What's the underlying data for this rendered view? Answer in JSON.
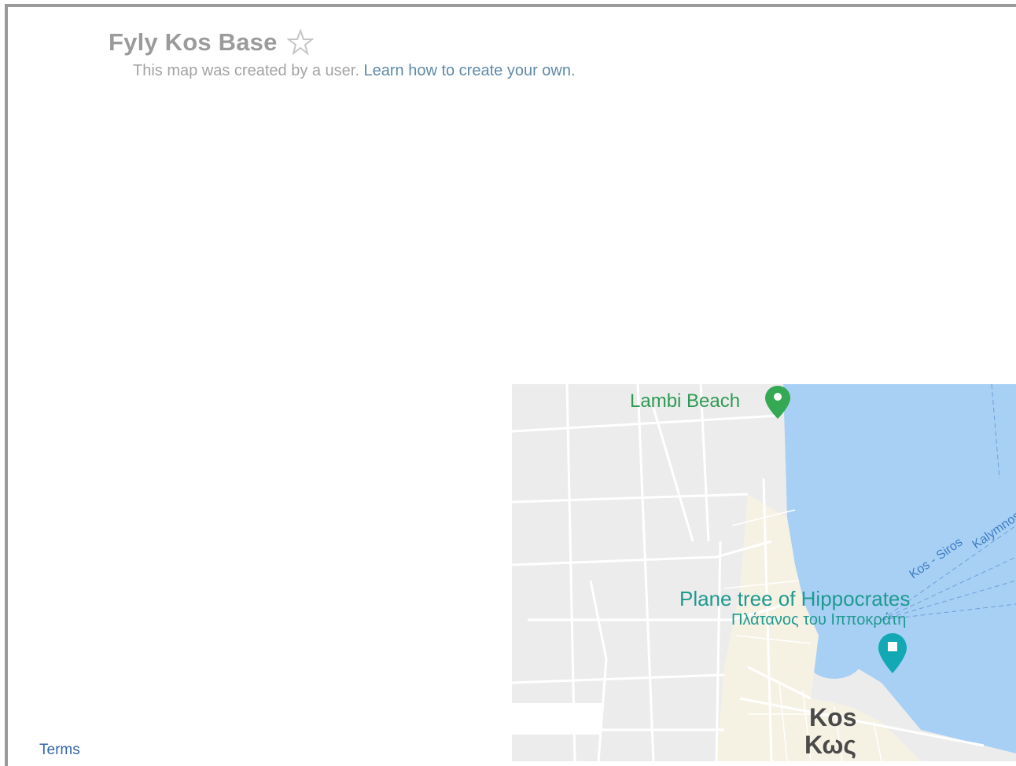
{
  "header": {
    "title": "Fyly Kos Base",
    "subtitle_text": "This map was created by a user.",
    "learn_link": "Learn how to create your own."
  },
  "footer": {
    "terms": "Terms"
  },
  "map": {
    "labels": {
      "beach": "Lambi Beach",
      "landmark_en": "Plane tree of Hippocrates",
      "landmark_el": "Πλάτανος του Ιπποκράτη",
      "city_en": "Kos",
      "city_el": "Κως",
      "ferry1": "Kos - Siros",
      "ferry2": "Kalymnos"
    },
    "colors": {
      "land": "#ececec",
      "sea": "#a8d0f5",
      "roads": "#ffffff",
      "beach_pin": "#34a853",
      "landmark_pin": "#12a9b5"
    },
    "icons": {
      "beach_pin": "beach-pin-icon",
      "landmark_pin": "landmark-pin-icon",
      "favorite": "star-icon"
    }
  }
}
